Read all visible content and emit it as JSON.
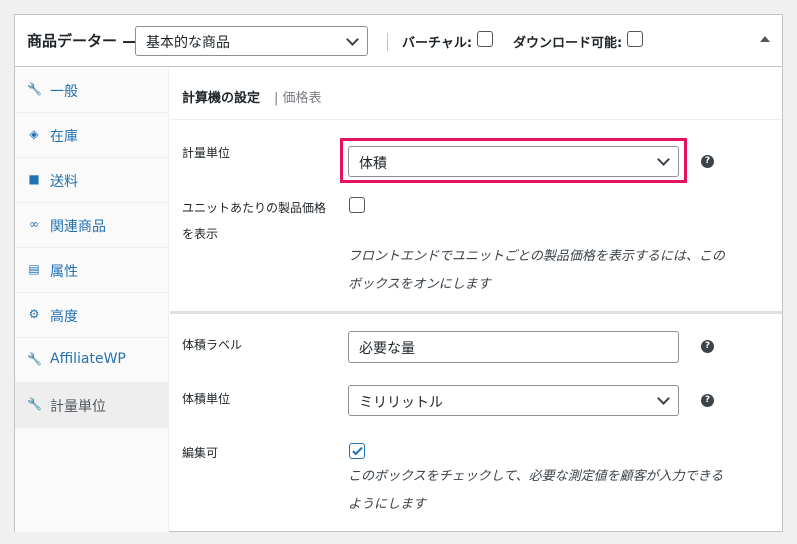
{
  "header": {
    "title": "商品データー —",
    "product_type": "基本的な商品",
    "virtual_label": "バーチャル:",
    "downloadable_label": "ダウンロード可能:"
  },
  "sidebar": {
    "items": [
      {
        "label": "一般",
        "icon": "wrench-icon"
      },
      {
        "label": "在庫",
        "icon": "tag-icon"
      },
      {
        "label": "送料",
        "icon": "truck-icon"
      },
      {
        "label": "関連商品",
        "icon": "link-icon"
      },
      {
        "label": "属性",
        "icon": "list-icon"
      },
      {
        "label": "高度",
        "icon": "gear-icon"
      },
      {
        "label": "AffiliateWP",
        "icon": "wrench-icon"
      },
      {
        "label": "計量単位",
        "icon": "wrench-icon"
      }
    ]
  },
  "main": {
    "tab_active": "計算機の設定",
    "tab_separator": "|",
    "tab_other": "価格表",
    "measurement_unit_label": "計量単位",
    "measurement_unit_value": "体積",
    "show_unit_price_label_1": "ユニットあたりの製品価格",
    "show_unit_price_label_2": "を表示",
    "show_unit_price_desc_1": "フロントエンドでユニットごとの製品価格を表示するには、この",
    "show_unit_price_desc_2": "ボックスをオンにします",
    "volume_label_label": "体積ラベル",
    "volume_label_value": "必要な量",
    "volume_unit_label": "体積単位",
    "volume_unit_value": "ミリリットル",
    "editable_label": "編集可",
    "editable_desc_1": "このボックスをチェックして、必要な測定値を顧客が入力できる",
    "editable_desc_2": "ようにします",
    "help_glyph": "?"
  },
  "colors": {
    "accent": "#2271b1",
    "highlight": "#e4125f"
  }
}
